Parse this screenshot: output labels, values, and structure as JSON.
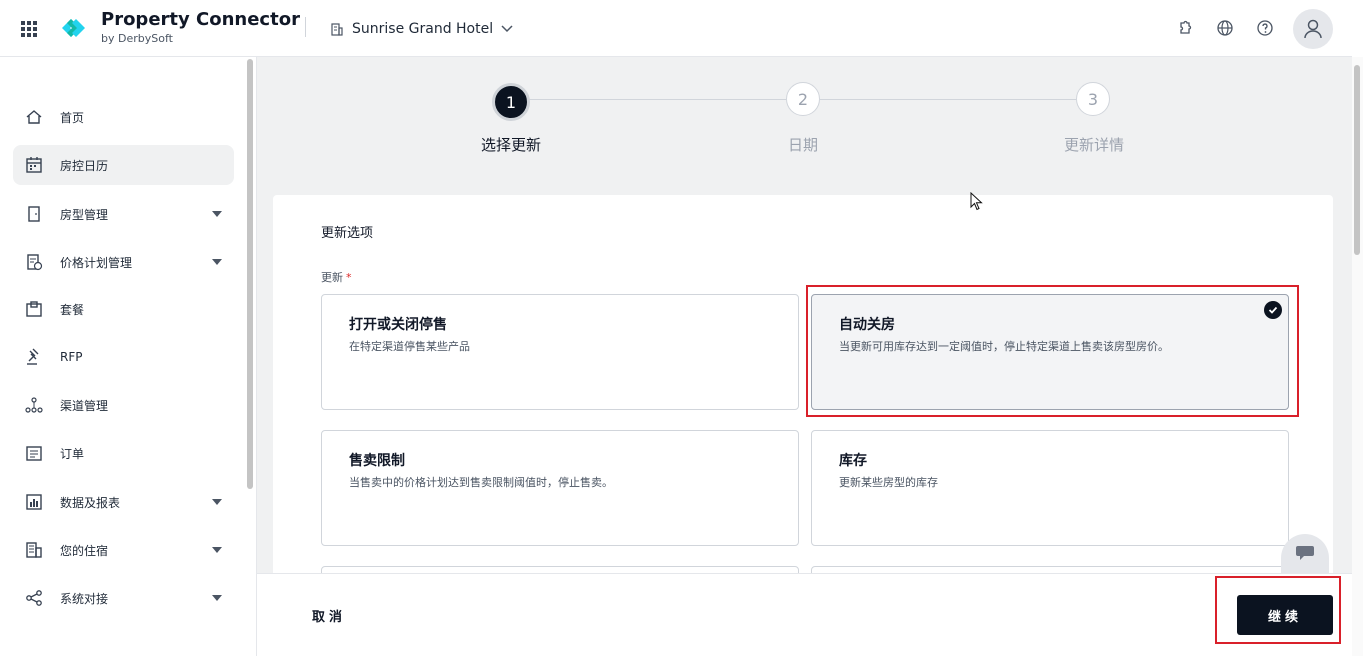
{
  "app": {
    "brand_name": "Property Connector",
    "brand_sub": "by DerbySoft",
    "hotel_name": "Sunrise Grand Hotel",
    "brand_color": "#22d3ee",
    "top_icons": [
      "puzzle-icon",
      "globe-icon",
      "help-icon",
      "user-avatar-icon"
    ]
  },
  "sidebar": {
    "items": [
      {
        "label": "首页",
        "icon": "home-icon",
        "expandable": false
      },
      {
        "label": "房控日历",
        "icon": "calendar-icon",
        "expandable": false,
        "active": true
      },
      {
        "label": "房型管理",
        "icon": "door-icon",
        "expandable": true
      },
      {
        "label": "价格计划管理",
        "icon": "price-plan-icon",
        "expandable": true
      },
      {
        "label": "套餐",
        "icon": "package-icon",
        "expandable": false
      },
      {
        "label": "RFP",
        "icon": "gavel-icon",
        "expandable": false
      },
      {
        "label": "渠道管理",
        "icon": "channel-icon",
        "expandable": false
      },
      {
        "label": "订单",
        "icon": "order-icon",
        "expandable": false
      },
      {
        "label": "数据及报表",
        "icon": "report-icon",
        "expandable": true
      },
      {
        "label": "您的住宿",
        "icon": "building-icon",
        "expandable": true
      },
      {
        "label": "系统对接",
        "icon": "share-icon",
        "expandable": true
      }
    ]
  },
  "stepper": {
    "steps": [
      {
        "number": "1",
        "label": "选择更新",
        "state": "active"
      },
      {
        "number": "2",
        "label": "日期",
        "state": "todo"
      },
      {
        "number": "3",
        "label": "更新详情",
        "state": "todo"
      }
    ]
  },
  "form": {
    "section_title": "更新选项",
    "field_label": "更新",
    "required_mark": "*",
    "options": [
      {
        "title": "打开或关闭停售",
        "desc": "在特定渠道停售某些产品",
        "selected": false
      },
      {
        "title": "自动关房",
        "desc": "当更新可用库存达到一定阈值时，停止特定渠道上售卖该房型房价。",
        "selected": true
      },
      {
        "title": "售卖限制",
        "desc": "当售卖中的价格计划达到售卖限制阈值时，停止售卖。",
        "selected": false
      },
      {
        "title": "库存",
        "desc": "更新某些房型的库存",
        "selected": false
      }
    ]
  },
  "footer": {
    "cancel_label": "取消",
    "continue_label": "继续"
  },
  "colors": {
    "primary_dark": "#0b1320",
    "highlight_red": "#d9202a",
    "background": "#f0f1f2"
  }
}
